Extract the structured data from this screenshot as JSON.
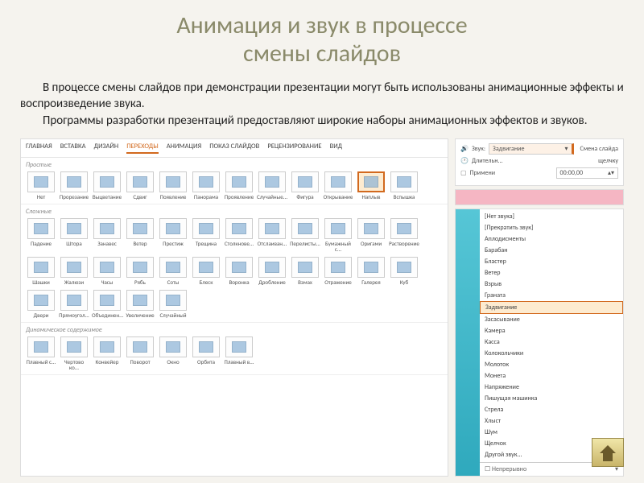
{
  "title_line1": "Анимация и звук в процессе",
  "title_line2": "смены слайдов",
  "paragraph1": "В процессе смены слайдов при демонстрации презентации могут быть использованы анимационные эффекты и воспроизведение звука.",
  "paragraph2": "Программы разработки презентаций предоставляют широкие наборы анимационных эффектов и звуков.",
  "ribbon": {
    "tabs": [
      "ГЛАВНАЯ",
      "ВСТАВКА",
      "ДИЗАЙН",
      "ПЕРЕХОДЫ",
      "АНИМАЦИЯ",
      "ПОКАЗ СЛАЙДОВ",
      "РЕЦЕНЗИРОВАНИЕ",
      "ВИД"
    ],
    "active": "ПЕРЕХОДЫ"
  },
  "groups": {
    "simple": {
      "label": "Простые",
      "items": [
        "Нет",
        "Прорезание",
        "Выцветание",
        "Сдвиг",
        "Появление",
        "Панорама",
        "Проявление",
        "Случайные...",
        "Фигура",
        "Открывание",
        "Наплыв",
        "Вспышка"
      ],
      "selected": "Наплыв"
    },
    "complex": {
      "label": "Сложные",
      "items": [
        "Падение",
        "Штора",
        "Занавес",
        "Ветер",
        "Престиж",
        "Трещина",
        "Столкнове...",
        "Отслаиван...",
        "Перелисты...",
        "Бумажный с...",
        "Оригами",
        "Растворение",
        "Шашки",
        "Жалюзи",
        "Часы",
        "Рябь",
        "Соты",
        "Блеск",
        "Воронка",
        "Дробление",
        "Взмах",
        "Отражение",
        "Галерея",
        "Куб",
        "Двери",
        "Прямоугол...",
        "Объединен...",
        "Увеличение",
        "Случайный"
      ]
    },
    "dynamic": {
      "label": "Динамическое содержимое",
      "items": [
        "Плавный с...",
        "Чертово ко...",
        "Конвейер",
        "Поворот",
        "Окно",
        "Орбита",
        "Плавный в..."
      ]
    }
  },
  "sound_panel": {
    "sound_label": "Звук:",
    "sound_value": "Задвигание",
    "duration_label": "Длительн...",
    "apply_label": "Примени",
    "change_label": "Смена слайда",
    "click_label": "щелчку",
    "time_value": "00:00,00"
  },
  "dropdown": {
    "items": [
      "[Нет звука]",
      "[Прекратить звук]",
      "Аплодисменты",
      "Барабан",
      "Бластер",
      "Ветер",
      "Взрыв",
      "Граната",
      "Задвигание",
      "Засасывание",
      "Камера",
      "Касса",
      "Колокольчики",
      "Молоток",
      "Монета",
      "Напряжение",
      "Пишущая машинка",
      "Стрела",
      "Хлыст",
      "Шум",
      "Щелчок",
      "Другой звук..."
    ],
    "selected": "Задвигание",
    "footer": "Непрерывно"
  }
}
